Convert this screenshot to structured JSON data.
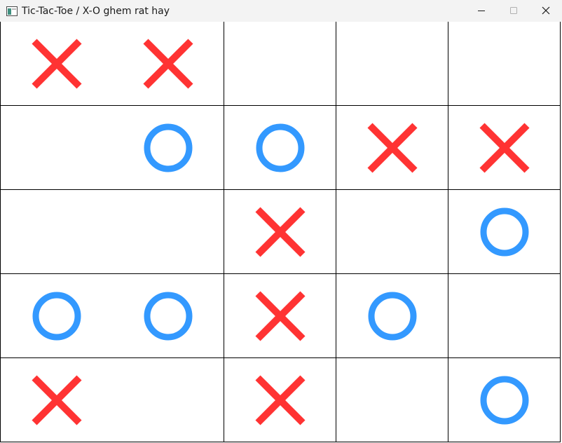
{
  "window": {
    "title": "Tic-Tac-Toe / X-O ghem rat hay"
  },
  "colors": {
    "x_mark": "#ff3333",
    "o_mark": "#3399ff",
    "grid_line": "#000000",
    "titlebar_bg": "#f3f3f3"
  },
  "icons": {
    "app": "app-window-icon",
    "minimize": "minimize-icon",
    "maximize": "maximize-icon",
    "close": "close-icon"
  },
  "board": {
    "rows": 5,
    "cols": 5,
    "cells": [
      [
        "X",
        "X",
        "",
        "",
        ""
      ],
      [
        "",
        "O",
        "O",
        "X",
        "X"
      ],
      [
        "",
        "",
        "X",
        "",
        "O"
      ],
      [
        "O",
        "O",
        "X",
        "O",
        ""
      ],
      [
        "X",
        "",
        "X",
        "",
        "O"
      ]
    ]
  }
}
